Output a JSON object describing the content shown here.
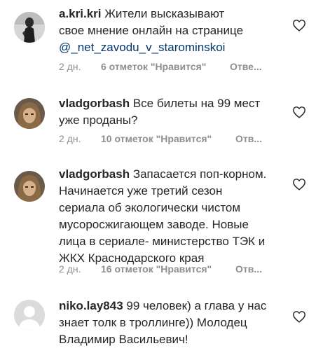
{
  "comments": [
    {
      "username": "a.kri.kri",
      "text": " Жители высказывают\nсвое мнение онлайн на странице",
      "mention": "@_net_zavodu_v_starominskoi",
      "time": "2 дн.",
      "likes": "6 отметок \"Нравится\"",
      "reply": "Отве...",
      "avatar_icon": "user-photo-icon"
    },
    {
      "username": "vladgorbash",
      "text": " Все билеты на 99 мест\nуже проданы?",
      "time": "2 дн.",
      "likes": "10 отметок \"Нравится\"",
      "reply": "Отв...",
      "avatar_icon": "user-photo-icon"
    },
    {
      "username": "vladgorbash",
      "text": " Запасается поп-корном.\nНачинается уже третий сезон\nсериала об экологически чистом\nмусоросжигающем заводе. Новые\nлица в сериале- министерство ТЭК и\nЖКХ Краснодарского края",
      "time": "2 дн.",
      "likes": "16 отметок \"Нравится\"",
      "reply": "Отв...",
      "avatar_icon": "user-photo-icon"
    },
    {
      "username": "niko.lay843",
      "text": " 99 человек) а глава у нас\nзнает толк в троллинге)) Молодец\nВладимир Васильевич!",
      "avatar_icon": "default-avatar-icon"
    }
  ],
  "colors": {
    "text": "#262626",
    "meta": "#8e8e8e",
    "mention": "#00376b"
  },
  "icons": {
    "like": "heart-outline-icon"
  }
}
